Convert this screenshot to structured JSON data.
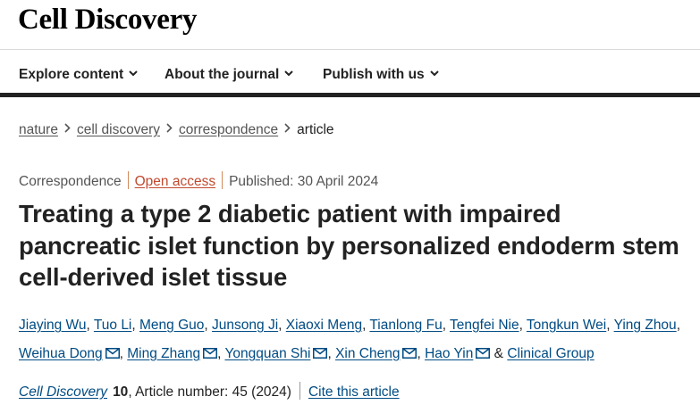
{
  "masthead": {
    "logo": "Cell Discovery"
  },
  "nav": {
    "items": [
      {
        "label": "Explore content"
      },
      {
        "label": "About the journal"
      },
      {
        "label": "Publish with us"
      }
    ]
  },
  "breadcrumb": {
    "items": [
      "nature",
      "cell discovery",
      "correspondence"
    ],
    "current": "article"
  },
  "meta": {
    "type": "Correspondence",
    "access": "Open access",
    "published": "Published: 30 April 2024"
  },
  "article": {
    "title": "Treating a type 2 diabetic patient with impaired pancreatic islet function by personalized endoderm stem cell-derived islet tissue"
  },
  "authors": {
    "list": [
      "Jiaying Wu",
      "Tuo Li",
      "Meng Guo",
      "Junsong Ji",
      "Xiaoxi Meng",
      "Tianlong Fu",
      "Tengfei Nie",
      "Tongkun Wei",
      "Ying Zhou",
      "Weihua Dong",
      "Ming Zhang",
      "Yongquan Shi",
      "Xin Cheng",
      "Hao Yin"
    ],
    "separator": ",",
    "ampersand": "&",
    "group": "Clinical Group",
    "icon": "mail-icon"
  },
  "citation": {
    "journal": "Cell Discovery",
    "volume": "10",
    "rest": ", Article number: 45 (2024)",
    "cite_label": "Cite this article"
  },
  "colors": {
    "link": "#004b83",
    "open_access": "#c0492e",
    "text": "#222222",
    "muted": "#555555"
  }
}
